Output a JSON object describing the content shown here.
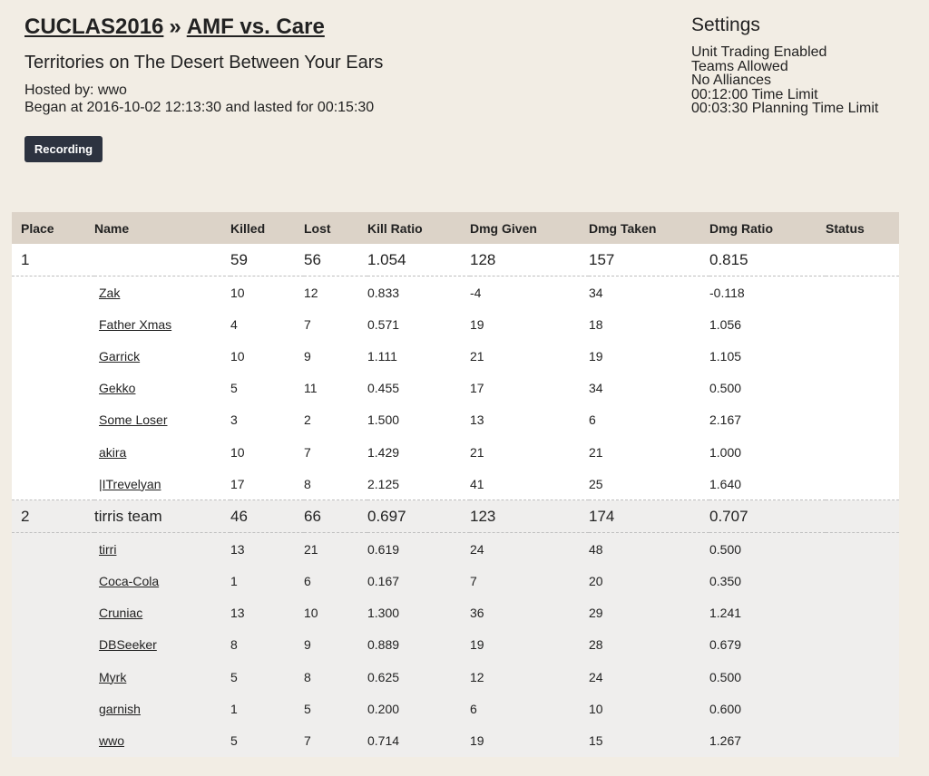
{
  "header": {
    "tournament_link": "CUCLAS2016",
    "separator": "»",
    "match_link": "AMF vs. Care",
    "subtitle": "Territories on The Desert Between Your Ears",
    "hosted_by": "Hosted by: wwo",
    "began": "Began at 2016-10-02 12:13:30 and lasted for 00:15:30",
    "recording_label": "Recording"
  },
  "settings": {
    "title": "Settings",
    "items": [
      "Unit Trading Enabled",
      "Teams Allowed",
      "No Alliances",
      "00:12:00 Time Limit",
      "00:03:30 Planning Time Limit"
    ]
  },
  "table": {
    "columns": [
      "Place",
      "Name",
      "Killed",
      "Lost",
      "Kill Ratio",
      "Dmg Given",
      "Dmg Taken",
      "Dmg Ratio",
      "Status"
    ],
    "teams": [
      {
        "place": "1",
        "name": "",
        "killed": "59",
        "lost": "56",
        "kill_ratio": "1.054",
        "dmg_given": "128",
        "dmg_taken": "157",
        "dmg_ratio": "0.815",
        "status": "",
        "players": [
          {
            "name": "Zak",
            "killed": "10",
            "lost": "12",
            "kill_ratio": "0.833",
            "dmg_given": "-4",
            "dmg_taken": "34",
            "dmg_ratio": "-0.118"
          },
          {
            "name": "Father Xmas",
            "killed": "4",
            "lost": "7",
            "kill_ratio": "0.571",
            "dmg_given": "19",
            "dmg_taken": "18",
            "dmg_ratio": "1.056"
          },
          {
            "name": "Garrick",
            "killed": "10",
            "lost": "9",
            "kill_ratio": "1.111",
            "dmg_given": "21",
            "dmg_taken": "19",
            "dmg_ratio": "1.105"
          },
          {
            "name": "Gekko",
            "killed": "5",
            "lost": "11",
            "kill_ratio": "0.455",
            "dmg_given": "17",
            "dmg_taken": "34",
            "dmg_ratio": "0.500"
          },
          {
            "name": "Some Loser",
            "killed": "3",
            "lost": "2",
            "kill_ratio": "1.500",
            "dmg_given": "13",
            "dmg_taken": "6",
            "dmg_ratio": "2.167"
          },
          {
            "name": "akira",
            "killed": "10",
            "lost": "7",
            "kill_ratio": "1.429",
            "dmg_given": "21",
            "dmg_taken": "21",
            "dmg_ratio": "1.000"
          },
          {
            "name": "|ITrevelyan",
            "killed": "17",
            "lost": "8",
            "kill_ratio": "2.125",
            "dmg_given": "41",
            "dmg_taken": "25",
            "dmg_ratio": "1.640"
          }
        ]
      },
      {
        "place": "2",
        "name": "tirris team",
        "killed": "46",
        "lost": "66",
        "kill_ratio": "0.697",
        "dmg_given": "123",
        "dmg_taken": "174",
        "dmg_ratio": "0.707",
        "status": "",
        "players": [
          {
            "name": "tirri",
            "killed": "13",
            "lost": "21",
            "kill_ratio": "0.619",
            "dmg_given": "24",
            "dmg_taken": "48",
            "dmg_ratio": "0.500"
          },
          {
            "name": "Coca-Cola",
            "killed": "1",
            "lost": "6",
            "kill_ratio": "0.167",
            "dmg_given": "7",
            "dmg_taken": "20",
            "dmg_ratio": "0.350"
          },
          {
            "name": "Cruniac",
            "killed": "13",
            "lost": "10",
            "kill_ratio": "1.300",
            "dmg_given": "36",
            "dmg_taken": "29",
            "dmg_ratio": "1.241"
          },
          {
            "name": "DBSeeker",
            "killed": "8",
            "lost": "9",
            "kill_ratio": "0.889",
            "dmg_given": "19",
            "dmg_taken": "28",
            "dmg_ratio": "0.679"
          },
          {
            "name": "Myrk",
            "killed": "5",
            "lost": "8",
            "kill_ratio": "0.625",
            "dmg_given": "12",
            "dmg_taken": "24",
            "dmg_ratio": "0.500"
          },
          {
            "name": "garnish",
            "killed": "1",
            "lost": "5",
            "kill_ratio": "0.200",
            "dmg_given": "6",
            "dmg_taken": "10",
            "dmg_ratio": "0.600"
          },
          {
            "name": "wwo",
            "killed": "5",
            "lost": "7",
            "kill_ratio": "0.714",
            "dmg_given": "19",
            "dmg_taken": "15",
            "dmg_ratio": "1.267"
          }
        ]
      }
    ]
  }
}
